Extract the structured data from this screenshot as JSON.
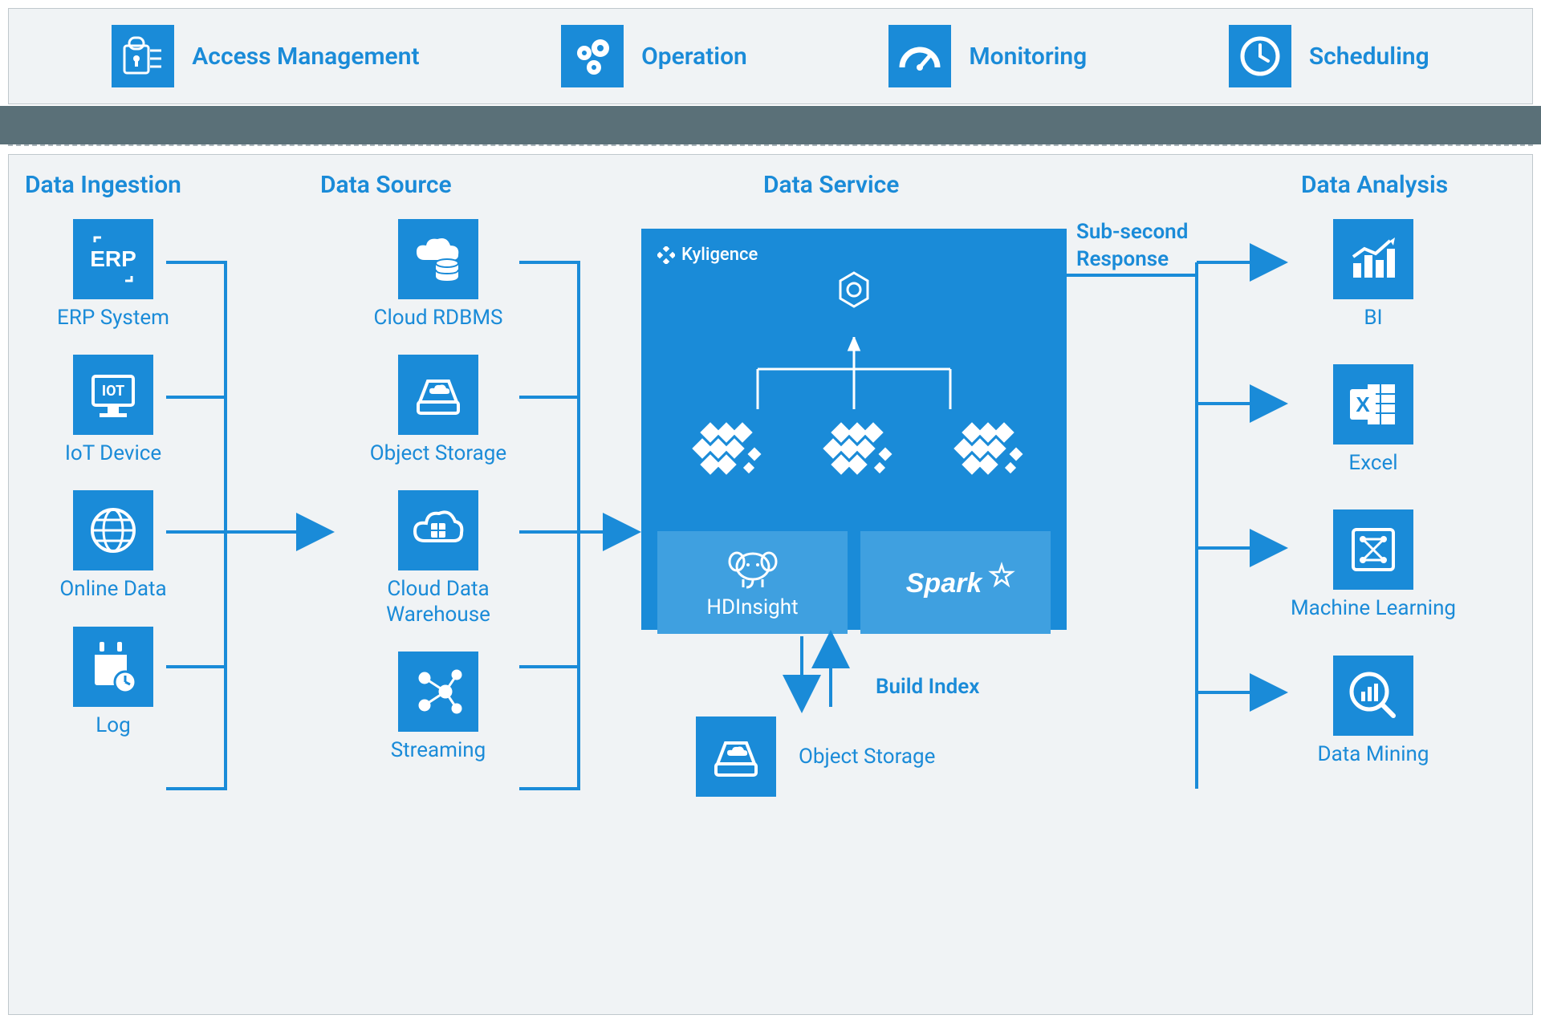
{
  "top": {
    "items": [
      {
        "label": "Access Management",
        "icon": "lock"
      },
      {
        "label": "Operation",
        "icon": "gears"
      },
      {
        "label": "Monitoring",
        "icon": "gauge"
      },
      {
        "label": "Scheduling",
        "icon": "clock"
      }
    ]
  },
  "sections": {
    "ingestion": "Data Ingestion",
    "source": "Data Source",
    "service": "Data Service",
    "analysis": "Data Analysis"
  },
  "ingestion": [
    {
      "label": "ERP System",
      "icon": "erp"
    },
    {
      "label": "IoT Device",
      "icon": "iot"
    },
    {
      "label": "Online Data",
      "icon": "globe"
    },
    {
      "label": "Log",
      "icon": "log"
    }
  ],
  "source": [
    {
      "label": "Cloud RDBMS",
      "icon": "cloud-db"
    },
    {
      "label": "Object Storage",
      "icon": "disk"
    },
    {
      "label": "Cloud Data\nWarehouse",
      "icon": "cloud-dw"
    },
    {
      "label": "Streaming",
      "icon": "stream"
    }
  ],
  "analysis": [
    {
      "label": "BI",
      "icon": "chart"
    },
    {
      "label": "Excel",
      "icon": "excel"
    },
    {
      "label": "Machine Learning",
      "icon": "ml"
    },
    {
      "label": "Data Mining",
      "icon": "magnify"
    }
  ],
  "service": {
    "brand": "Kyligence",
    "engines": [
      {
        "label": "HDInsight",
        "icon": "elephant"
      },
      {
        "label": "",
        "icon": "spark"
      }
    ]
  },
  "bottom_storage": {
    "label": "Object Storage"
  },
  "labels": {
    "build_index": "Build Index",
    "sub_second": "Sub-second\nResponse"
  },
  "colors": {
    "primary": "#1a8bd8",
    "panel": "#f0f3f5",
    "band": "#5a7078"
  }
}
